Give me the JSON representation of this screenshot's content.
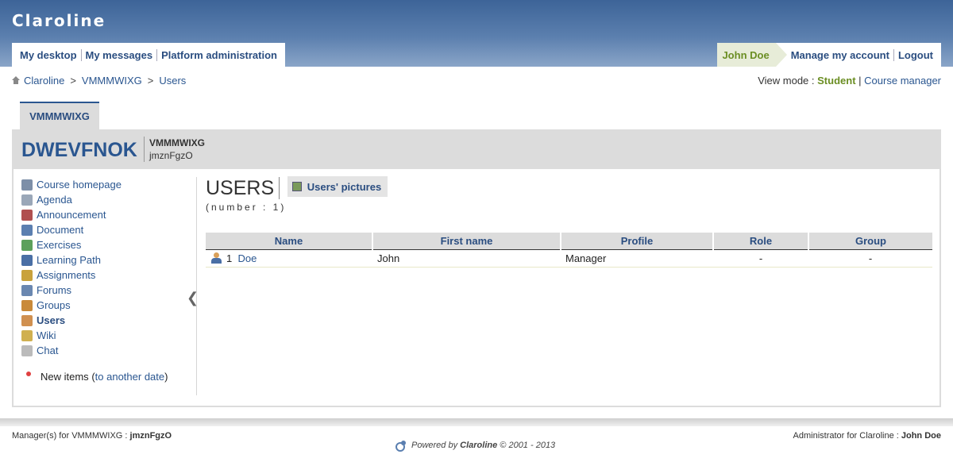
{
  "app": {
    "name": "Claroline"
  },
  "topnav": {
    "left": [
      "My desktop",
      "My messages",
      "Platform administration"
    ],
    "user": "John Doe",
    "account": "Manage my account",
    "logout": "Logout"
  },
  "breadcrumb": {
    "items": [
      "Claroline",
      "VMMMWIXG",
      "Users"
    ],
    "separator": ">"
  },
  "viewmode": {
    "label": "View mode :",
    "student": "Student",
    "separator": "|",
    "manager": "Course manager"
  },
  "course": {
    "tab": "VMMMWIXG",
    "code": "DWEVFNOK",
    "title": "VMMMWIXG",
    "manager": "jmznFgzO"
  },
  "sidebar": {
    "tools": [
      {
        "label": "Course homepage",
        "icon": "course-homepage-icon",
        "color": "#7d8fa8"
      },
      {
        "label": "Agenda",
        "icon": "agenda-icon",
        "color": "#9aa7b8"
      },
      {
        "label": "Announcement",
        "icon": "announcement-icon",
        "color": "#b05050"
      },
      {
        "label": "Document",
        "icon": "document-icon",
        "color": "#5b7fb0"
      },
      {
        "label": "Exercises",
        "icon": "exercises-icon",
        "color": "#5ca05c"
      },
      {
        "label": "Learning Path",
        "icon": "learning-path-icon",
        "color": "#4a6fa5"
      },
      {
        "label": "Assignments",
        "icon": "assignments-icon",
        "color": "#c9a23c"
      },
      {
        "label": "Forums",
        "icon": "forums-icon",
        "color": "#6a87b0"
      },
      {
        "label": "Groups",
        "icon": "groups-icon",
        "color": "#c98a3a"
      },
      {
        "label": "Users",
        "icon": "users-icon",
        "color": "#d09050"
      },
      {
        "label": "Wiki",
        "icon": "wiki-icon",
        "color": "#d0b050"
      },
      {
        "label": "Chat",
        "icon": "chat-icon",
        "color": "#bbbbbb"
      }
    ],
    "active_index": 9,
    "new_items_label": "New items",
    "new_items_open": "(",
    "new_items_link": "to another date",
    "new_items_close": ")"
  },
  "content": {
    "title": "USERS",
    "pictures_button": "Users' pictures",
    "count_label": "(number : 1)",
    "table": {
      "headers": [
        "Name",
        "First name",
        "Profile",
        "Role",
        "Group"
      ],
      "rows": [
        {
          "num": "1",
          "name": "Doe",
          "first_name": "John",
          "profile": "Manager",
          "role": "-",
          "group": "-"
        }
      ]
    }
  },
  "footer": {
    "left_label": "Manager(s) for VMMMWIXG :",
    "left_value": "jmznFgzO",
    "right_label": "Administrator for Claroline :",
    "right_value": "John Doe",
    "powered_prefix": "Powered by",
    "powered_brand": "Claroline",
    "powered_suffix": "© 2001 - 2013"
  }
}
